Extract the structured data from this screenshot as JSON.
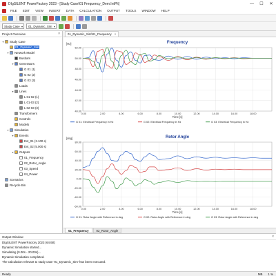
{
  "window": {
    "title": "DIgSILENT PowerFactory 2023 - [Study Case\\01 Frequency_Dem.IntPlt]"
  },
  "menu": [
    "FILE",
    "EDIT",
    "VIEW",
    "INSERT",
    "DATA",
    "CALCULATION",
    "OUTPUT",
    "TOOLS",
    "WINDOW",
    "HELP"
  ],
  "toolbar": {
    "combo1": "Study Case",
    "combo2": "01_Dynamic_Sim"
  },
  "project_overview": {
    "title": "Project Overview",
    "items": [
      {
        "label": "Study Case",
        "level": 0,
        "tog": "▾",
        "icon": "#e2b33a"
      },
      {
        "label": "01_Dynamic_Sim",
        "level": 1,
        "tog": "",
        "icon": "#e2b33a",
        "selected": true
      },
      {
        "label": "Network Model",
        "level": 1,
        "tog": "▾",
        "icon": "#7aa0d8"
      },
      {
        "label": "Busbars",
        "level": 2,
        "tog": "",
        "icon": "#3a3a3a"
      },
      {
        "label": "Generators",
        "level": 2,
        "tog": "▾",
        "icon": "#5b7fc4"
      },
      {
        "label": "G 01 (1)",
        "level": 3,
        "tog": "",
        "icon": "#5b7fc4"
      },
      {
        "label": "G 02 (2)",
        "level": 3,
        "tog": "",
        "icon": "#5b7fc4"
      },
      {
        "label": "G 03 (3)",
        "level": 3,
        "tog": "",
        "icon": "#5b7fc4"
      },
      {
        "label": "Loads",
        "level": 2,
        "tog": "",
        "icon": "#8a8a8a"
      },
      {
        "label": "Lines",
        "level": 2,
        "tog": "▾",
        "icon": "#8a8a8a"
      },
      {
        "label": "L 01-02 (1)",
        "level": 3,
        "tog": "",
        "icon": "#8a8a8a"
      },
      {
        "label": "L 01-03 (2)",
        "level": 3,
        "tog": "",
        "icon": "#8a8a8a"
      },
      {
        "label": "L 02-03 (3)",
        "level": 3,
        "tog": "",
        "icon": "#8a8a8a"
      },
      {
        "label": "Transformers",
        "level": 2,
        "tog": "",
        "icon": "#8a8a8a"
      },
      {
        "label": "Controls",
        "level": 2,
        "tog": "",
        "icon": "#e2b33a"
      },
      {
        "label": "Models",
        "level": 2,
        "tog": "",
        "icon": "#e2b33a"
      },
      {
        "label": "Simulation",
        "level": 1,
        "tog": "▾",
        "icon": "#7aa0d8"
      },
      {
        "label": "Events",
        "level": 2,
        "tog": "▾",
        "icon": "#e2b33a"
      },
      {
        "label": "Evt_01 (3.100 s)",
        "level": 3,
        "tog": "",
        "icon": "#c94a4a"
      },
      {
        "label": "Evt_02 (5.000 s)",
        "level": 3,
        "tog": "",
        "icon": "#c94a4a"
      },
      {
        "label": "Outputs",
        "level": 2,
        "tog": "▾",
        "icon": "#e2b33a"
      },
      {
        "label": "01_Frequency",
        "level": 3,
        "tog": "",
        "icon": "#ffffff"
      },
      {
        "label": "02_Rotor_Angle",
        "level": 3,
        "tog": "",
        "icon": "#ffffff"
      },
      {
        "label": "03_Speed",
        "level": 3,
        "tog": "",
        "icon": "#ffffff"
      },
      {
        "label": "04_Power",
        "level": 3,
        "tog": "",
        "icon": "#ffffff"
      },
      {
        "label": "Scenarios",
        "level": 0,
        "tog": "",
        "icon": "#7aa0d8"
      },
      {
        "label": "Recycle Bin",
        "level": 0,
        "tog": "",
        "icon": "#8a8a8a"
      }
    ]
  },
  "doc": {
    "tab": "01_Dynamic_Sim\\01_Frequency",
    "bottom_tabs": [
      "01_Frequency",
      "02_Rotor_Angle"
    ]
  },
  "chart_data": [
    {
      "type": "line",
      "title": "Frequency",
      "ylabel": "[Hz]",
      "xlabel": "Time [s]",
      "ylim": [
        40,
        52
      ],
      "yticks": [
        "52.00",
        "50.00",
        "48.00",
        "46.00",
        "44.00",
        "42.00",
        "40.00"
      ],
      "xlim": [
        -0.1,
        20
      ],
      "xticks": [
        "0.00",
        "2.00",
        "4.00",
        "6.00",
        "8.00",
        "10.00",
        "12.00",
        "14.00",
        "16.00",
        "18.00"
      ],
      "x": [
        -0.1,
        0,
        0.5,
        1.0,
        1.5,
        2.0,
        2.5,
        3.0,
        3.5,
        4.0,
        4.5,
        5.0,
        5.5,
        6.0,
        6.5,
        7.0,
        7.5,
        8.0,
        9,
        10,
        11,
        12,
        13,
        14,
        15,
        16,
        17,
        18,
        19,
        20
      ],
      "series": [
        {
          "name": "G 01: Electrical Frequency in Hz",
          "color": "#3366cc",
          "values": [
            50.0,
            50.0,
            50.1,
            51.4,
            49.2,
            47.4,
            50.8,
            51.9,
            49.6,
            48.3,
            50.5,
            51.2,
            49.6,
            49.1,
            50.5,
            50.6,
            49.7,
            49.6,
            50.4,
            49.8,
            50.3,
            49.8,
            50.2,
            49.9,
            50.1,
            49.9,
            50.1,
            50.0,
            50.0,
            50.0
          ]
        },
        {
          "name": "G 02: Electrical Frequency in Hz",
          "color": "#d64545",
          "values": [
            50.0,
            50.0,
            49.8,
            48.4,
            51.3,
            51.7,
            48.6,
            48.1,
            51.4,
            51.2,
            48.8,
            49.3,
            51.0,
            50.6,
            49.2,
            49.6,
            50.6,
            50.3,
            49.6,
            50.3,
            49.7,
            50.2,
            49.8,
            50.1,
            49.9,
            50.1,
            49.9,
            50.0,
            50.0,
            50.0
          ]
        },
        {
          "name": "G 03: Electrical Frequency in Hz",
          "color": "#3f9a4a",
          "values": [
            50.0,
            50.0,
            50.0,
            49.4,
            48.0,
            50.5,
            52.0,
            49.4,
            47.9,
            50.5,
            51.5,
            49.3,
            48.8,
            50.7,
            50.9,
            49.4,
            49.7,
            50.5,
            49.9,
            50.2,
            49.9,
            50.1,
            49.9,
            50.1,
            49.95,
            50.05,
            49.97,
            50.0,
            50.0,
            50.0
          ]
        }
      ]
    },
    {
      "type": "line",
      "title": "Rotor Angle",
      "ylabel": "[deg]",
      "xlabel": "Time [s]",
      "ylim": [
        -60,
        80
      ],
      "yticks": [
        "80.00",
        "60.00",
        "40.00",
        "20.00",
        "0.00",
        "-20.00",
        "-40.00",
        "-60.00"
      ],
      "xlim": [
        -0.1,
        20
      ],
      "xticks": [
        "0.00",
        "2.00",
        "4.00",
        "6.00",
        "8.00",
        "10.00",
        "12.00",
        "14.00",
        "16.00",
        "18.00"
      ],
      "x": [
        -0.1,
        0,
        0.5,
        1.0,
        1.5,
        2.0,
        2.5,
        3.0,
        3.5,
        4.0,
        4.5,
        5.0,
        5.5,
        6.0,
        6.5,
        7.0,
        7.5,
        8.0,
        9,
        10,
        11,
        12,
        13,
        14,
        15,
        16,
        17,
        18,
        19,
        20
      ],
      "series": [
        {
          "name": "G 01: Rotor Angle with Reference in deg",
          "color": "#3366cc",
          "values": [
            25,
            25,
            28,
            45,
            60,
            68,
            55,
            40,
            38,
            52,
            60,
            55,
            42,
            38,
            48,
            55,
            50,
            42,
            44,
            50,
            44,
            48,
            45,
            47,
            45,
            46,
            45,
            46,
            45,
            45
          ]
        },
        {
          "name": "G 02: Rotor Angle with Reference in deg",
          "color": "#d64545",
          "values": [
            20,
            20,
            18,
            5,
            -10,
            5,
            22,
            33,
            20,
            10,
            18,
            30,
            25,
            14,
            16,
            26,
            26,
            18,
            20,
            24,
            18,
            22,
            19,
            21,
            20,
            21,
            20,
            20,
            20,
            20
          ]
        },
        {
          "name": "G 03: Rotor Angle with Reference in deg",
          "color": "#3f9a4a",
          "values": [
            0,
            0,
            -2,
            -18,
            -30,
            -15,
            5,
            -5,
            -22,
            -12,
            2,
            -4,
            -15,
            -10,
            -2,
            -5,
            -12,
            -8,
            -4,
            -8,
            -4,
            -6,
            -5,
            -6,
            -5,
            -5,
            -5,
            -5,
            -5,
            -5
          ]
        }
      ]
    }
  ],
  "output_window": {
    "title": "Output Window",
    "lines": [
      "DIgSILENT PowerFactory 2023 (64 Bit)",
      "Dynamic Simulation started...",
      "Simulating (0.00s - 20.00s)...",
      "Dynamic Simulation completed.",
      "The calculation relevant to study case '01_Dynamic_Sim' has been executed."
    ]
  },
  "status": {
    "left": "Ready",
    "right1": "MB",
    "right2": "1 %"
  }
}
